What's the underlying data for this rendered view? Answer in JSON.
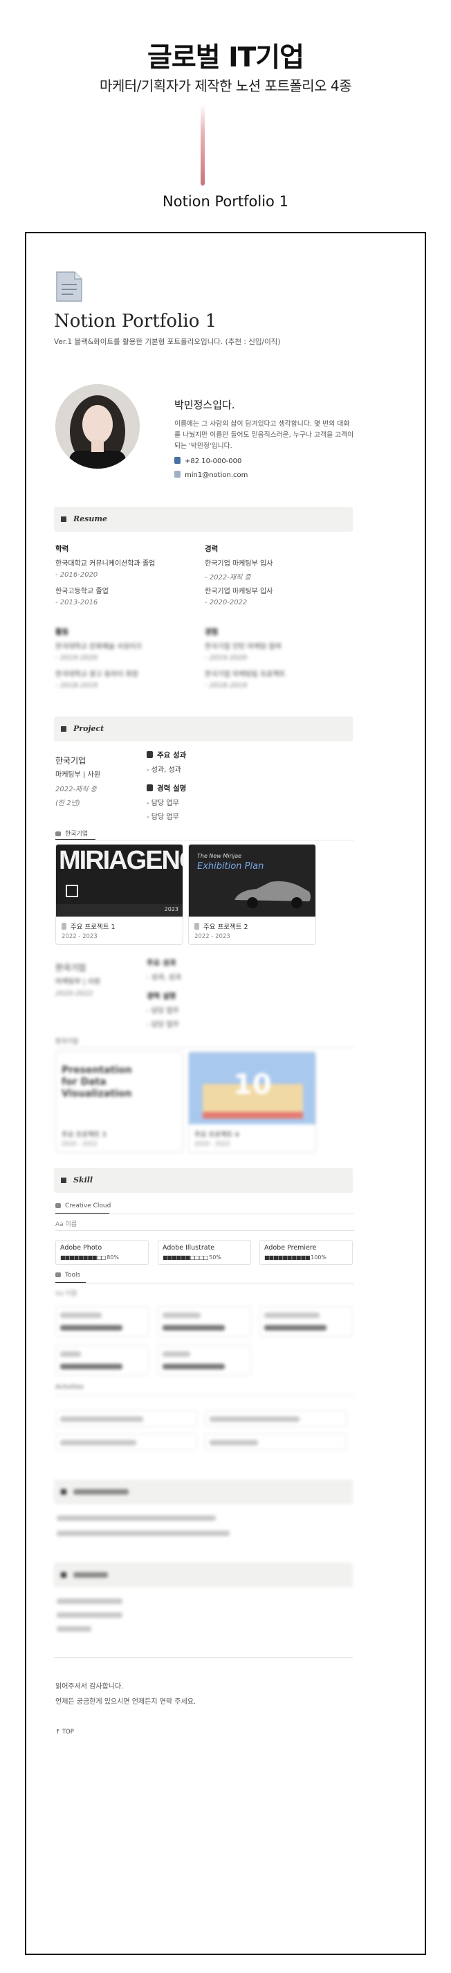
{
  "header": {
    "title": "글로벌 IT기업",
    "subtitle": "마케터/기획자가 제작한 노션 포트폴리오 4종",
    "caption": "Notion Portfolio 1"
  },
  "page": {
    "title": "Notion Portfolio 1",
    "description": "Ver.1 블랙&화이트를 활용한 기본형 포트폴리오입니다. (추천 : 신입/이직)"
  },
  "profile": {
    "name": "박민정스입다.",
    "intro": "이름에는 그 사람의 삶이 담겨있다고 생각합니다. 몇 번의 대화를 나눴지만 이름만 들어도 믿음직스러운, 누구나 고객을 고객이 되는 '박민정'입니다.",
    "phone": "+82 10-000-000",
    "email": "min1@notion.com"
  },
  "resume": {
    "heading": "Resume",
    "education_label": "학력",
    "education": [
      {
        "name": "한국대학교 커뮤니케이션학과 졸업",
        "period": "- 2016-2020"
      },
      {
        "name": "한국고등학교 졸업",
        "period": "- 2013-2016"
      }
    ],
    "career_label": "경력",
    "career": [
      {
        "name": "한국기업 마케팅부 입사",
        "period": "- 2022-재직 중"
      },
      {
        "name": "한국기업 마케팅부 입사",
        "period": "- 2020-2022"
      }
    ],
    "blurred_left_label": "활동",
    "blurred_right_label": "경험",
    "blurred_items": [
      "한국대학교 문화예술 서포터즈",
      "- 2019-2020",
      "한국대학교 광고 동아리 회장",
      "- 2018-2019"
    ],
    "blurred_items_right": [
      "한국기업 인턴 마케팅 참여",
      "- 2019-2020",
      "한국기업 마케팅팀 프로젝트",
      "- 2018-2019"
    ]
  },
  "project": {
    "heading": "Project",
    "company": "한국기업",
    "team": "마케팅부 | 사원",
    "period": "2022-재직 중",
    "duration": "(한 2년)",
    "main_results_label": "주요 성과",
    "main_results": "- 성과, 성과",
    "experience_label": "경력 설명",
    "experience": [
      "- 담당 업무",
      "- 담당 업무"
    ],
    "gallery_tab": "한국기업",
    "cards": [
      {
        "title": "주요 프로젝트 1",
        "date": "2022 - 2023",
        "thumb_text": "MIRIAGENCY",
        "thumb_year": "2023"
      },
      {
        "title": "주요 프로젝트 2",
        "date": "2022 - 2023",
        "thumb_kicker": "The New Mirijae",
        "thumb_text": "Exhibition Plan"
      }
    ],
    "blurred_company": "한국기업",
    "blurred_team": "마케팅부 | 사원",
    "blurred_period": "2020-2022",
    "blurred_tab": "한국기업",
    "blurred_cards": [
      {
        "title": "주요 프로젝트 3",
        "date": "2020 - 2022",
        "thumb_text": "Presentation for Data Visualization"
      },
      {
        "title": "주요 프로젝트 4",
        "date": "2020 - 2022",
        "thumb_text": "10"
      }
    ]
  },
  "skill": {
    "heading": "Skill",
    "tab1": "Creative Cloud",
    "filter": "Aa 이름",
    "tools": [
      {
        "name": "Adobe Photo",
        "bar": "■■■■■■■■□□",
        "pct": "80%"
      },
      {
        "name": "Adobe Illustrate",
        "bar": "■■■■■■□□□□",
        "pct": "50%"
      },
      {
        "name": "Adobe Premiere",
        "bar": "■■■■■■■■■■",
        "pct": "100%"
      }
    ],
    "tab2": "Tools",
    "tab3": "Activities"
  },
  "footer": {
    "thanks": "읽어주셔서 감사합니다.",
    "contact": "언제든 궁금한게 있으시면 언제든지 연락 주세요.",
    "top": "TOP"
  },
  "colors": {
    "accent_line": "#c9747c",
    "frame": "#1a1a1a",
    "section_bar": "#f1f1ef"
  }
}
